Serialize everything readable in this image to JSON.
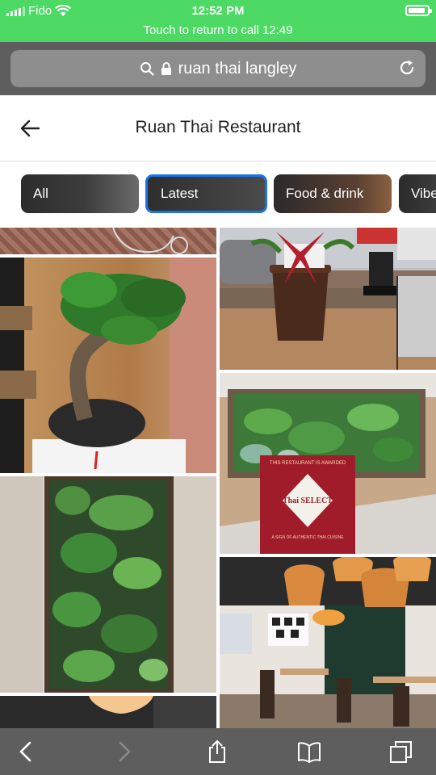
{
  "status_bar": {
    "carrier": "Fido",
    "time": "12:52 PM",
    "call_banner": "Touch to return to call 12:49"
  },
  "browser": {
    "url_text": "ruan thai langley"
  },
  "page": {
    "title": "Ruan Thai Restaurant"
  },
  "filters": [
    {
      "label": "All",
      "selected": false
    },
    {
      "label": "Latest",
      "selected": true
    },
    {
      "label": "Food & drink",
      "selected": false
    },
    {
      "label": "Vibe",
      "selected": false
    }
  ],
  "photos": {
    "card_heading": "THIS RESTAURANT IS AWARDED",
    "card_logo": "Thai SELECT",
    "card_tagline": "A SIGN OF AUTHENTIC THAI CUISINE"
  },
  "colors": {
    "call_banner": "#4cd964",
    "browser_chrome": "#5e5e5e",
    "selected_chip_border": "#1a73e8"
  },
  "icons": [
    "wifi-icon",
    "lock-icon",
    "search-icon",
    "reload-icon",
    "back-arrow-icon",
    "toolbar-back-icon",
    "toolbar-forward-icon",
    "share-icon",
    "bookmarks-icon",
    "tabs-icon"
  ]
}
